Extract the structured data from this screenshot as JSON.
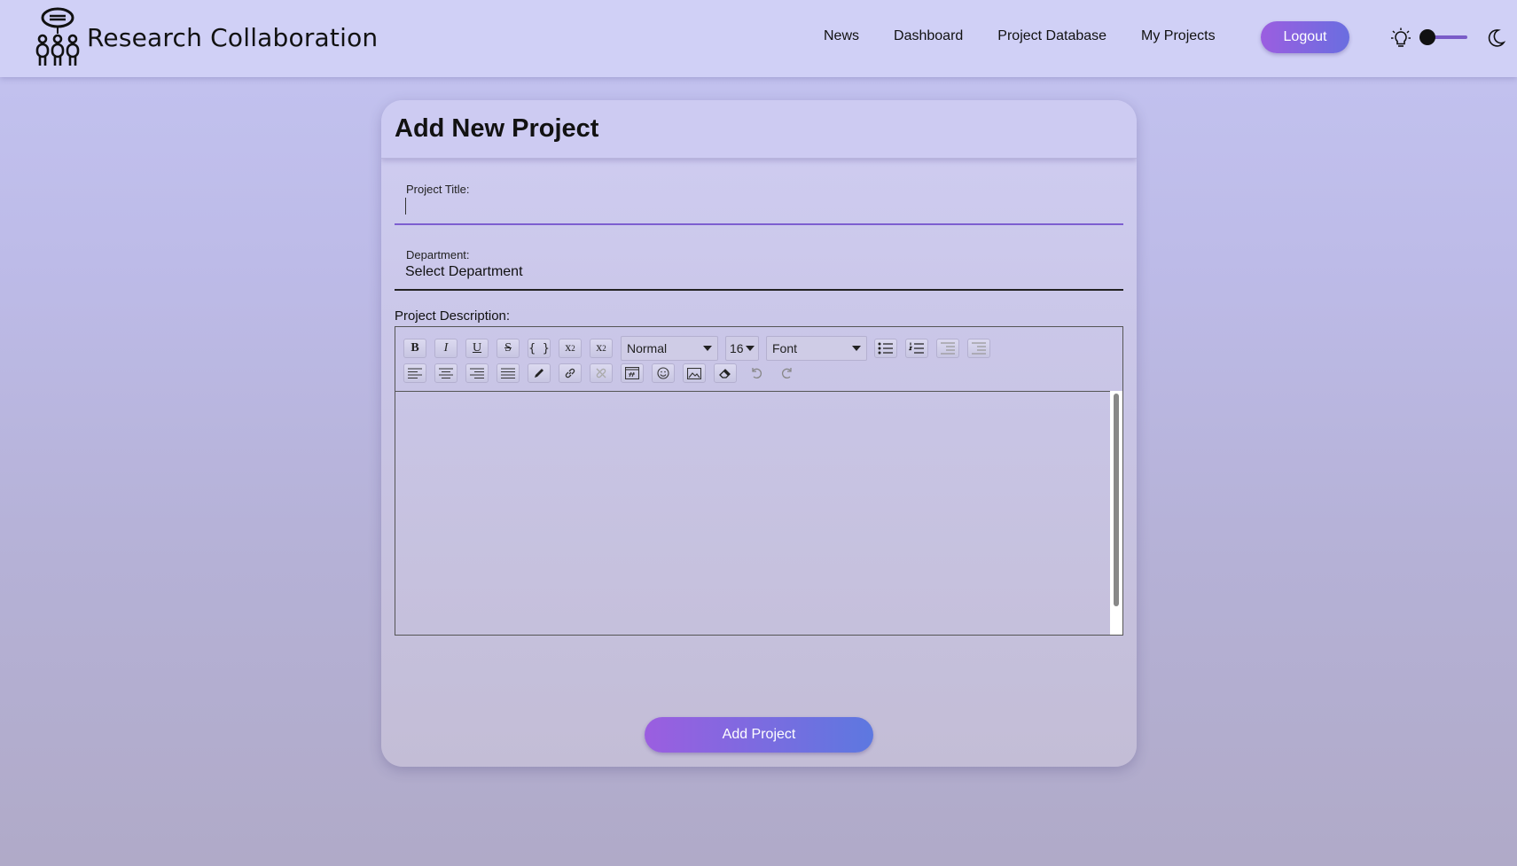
{
  "brand": {
    "name": "Research Collaboration",
    "logo_icon": "team-icon"
  },
  "nav": {
    "items": [
      "News",
      "Dashboard",
      "Project Database",
      "My Projects"
    ]
  },
  "header": {
    "logout_label": "Logout",
    "theme_toggle": {
      "light_icon": "lightbulb-icon",
      "dark_icon": "moon-icon",
      "state": "light"
    }
  },
  "form": {
    "title": "Add New Project",
    "project_title_label": "Project Title:",
    "project_title_value": "",
    "department_label": "Department:",
    "department_value": "Select Department",
    "description_label": "Project Description:",
    "toolbar": {
      "row1": [
        "bold",
        "italic",
        "underline",
        "strikethrough",
        "code",
        "superscript",
        "subscript"
      ],
      "block_type": "Normal",
      "font_size": "16",
      "font_family": "Font",
      "row1_end": [
        "bullet-list",
        "numbered-list",
        "indent",
        "outdent"
      ],
      "row2": [
        "align-left",
        "align-center",
        "align-right",
        "justify",
        "color-picker",
        "link",
        "unlink",
        "embed",
        "emoji",
        "image",
        "remove-format",
        "undo",
        "redo"
      ]
    },
    "submit_label": "Add Project"
  },
  "colors": {
    "accent": "#7d5ed0",
    "button_start": "#9b5ee0",
    "button_end": "#5d78e0"
  }
}
